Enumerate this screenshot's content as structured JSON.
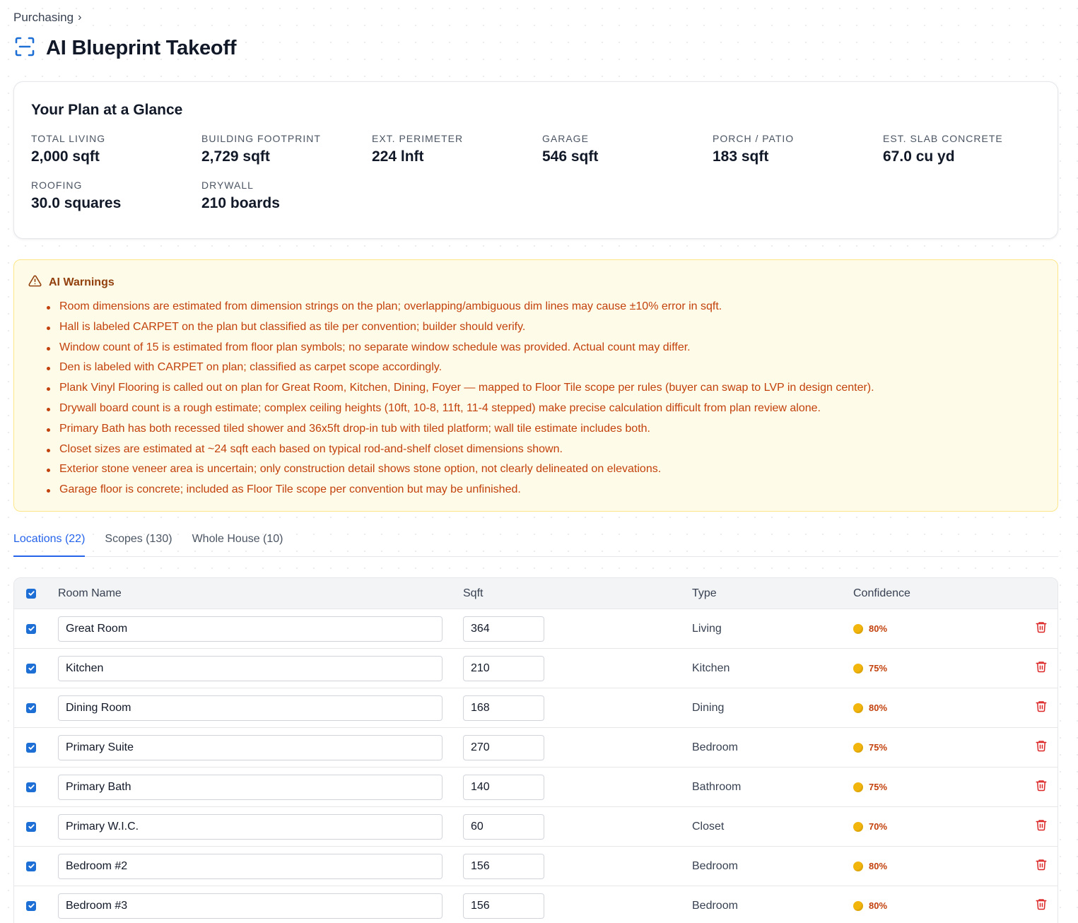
{
  "breadcrumb": {
    "parent": "Purchasing",
    "sep": "›"
  },
  "page": {
    "title": "AI Blueprint Takeoff"
  },
  "glance": {
    "heading": "Your Plan at a Glance",
    "metrics": [
      {
        "label": "TOTAL LIVING",
        "value": "2,000 sqft"
      },
      {
        "label": "BUILDING FOOTPRINT",
        "value": "2,729 sqft"
      },
      {
        "label": "EXT. PERIMETER",
        "value": "224 lnft"
      },
      {
        "label": "GARAGE",
        "value": "546 sqft"
      },
      {
        "label": "PORCH / PATIO",
        "value": "183 sqft"
      },
      {
        "label": "EST. SLAB CONCRETE",
        "value": "67.0 cu yd"
      },
      {
        "label": "ROOFING",
        "value": "30.0 squares"
      },
      {
        "label": "DRYWALL",
        "value": "210 boards"
      }
    ]
  },
  "warnings": {
    "heading": "AI Warnings",
    "items": [
      "Room dimensions are estimated from dimension strings on the plan; overlapping/ambiguous dim lines may cause ±10% error in sqft.",
      "Hall is labeled CARPET on the plan but classified as tile per convention; builder should verify.",
      "Window count of 15 is estimated from floor plan symbols; no separate window schedule was provided. Actual count may differ.",
      "Den is labeled with CARPET on plan; classified as carpet scope accordingly.",
      "Plank Vinyl Flooring is called out on plan for Great Room, Kitchen, Dining, Foyer — mapped to Floor Tile scope per rules (buyer can swap to LVP in design center).",
      "Drywall board count is a rough estimate; complex ceiling heights (10ft, 10-8, 11ft, 11-4 stepped) make precise calculation difficult from plan review alone.",
      "Primary Bath has both recessed tiled shower and 36x5ft drop-in tub with tiled platform; wall tile estimate includes both.",
      "Closet sizes are estimated at ~24 sqft each based on typical rod-and-shelf closet dimensions shown.",
      "Exterior stone veneer area is uncertain; only construction detail shows stone option, not clearly delineated on elevations.",
      "Garage floor is concrete; included as Floor Tile scope per convention but may be unfinished."
    ]
  },
  "tabs": [
    {
      "label": "Locations (22)",
      "active": true
    },
    {
      "label": "Scopes (130)",
      "active": false
    },
    {
      "label": "Whole House (10)",
      "active": false
    }
  ],
  "table": {
    "columns": {
      "name": "Room Name",
      "sqft": "Sqft",
      "type": "Type",
      "confidence": "Confidence"
    },
    "rows": [
      {
        "name": "Great Room",
        "sqft": "364",
        "type": "Living",
        "confidence": "80%"
      },
      {
        "name": "Kitchen",
        "sqft": "210",
        "type": "Kitchen",
        "confidence": "75%"
      },
      {
        "name": "Dining Room",
        "sqft": "168",
        "type": "Dining",
        "confidence": "80%"
      },
      {
        "name": "Primary Suite",
        "sqft": "270",
        "type": "Bedroom",
        "confidence": "75%"
      },
      {
        "name": "Primary Bath",
        "sqft": "140",
        "type": "Bathroom",
        "confidence": "75%"
      },
      {
        "name": "Primary W.I.C.",
        "sqft": "60",
        "type": "Closet",
        "confidence": "70%"
      },
      {
        "name": "Bedroom #2",
        "sqft": "156",
        "type": "Bedroom",
        "confidence": "80%"
      },
      {
        "name": "Bedroom #3",
        "sqft": "156",
        "type": "Bedroom",
        "confidence": "80%"
      }
    ]
  },
  "icons": {
    "title": "scan-icon",
    "warning": "alert-triangle-icon",
    "delete": "trash-icon",
    "confidence": "confidence-dot-icon"
  },
  "colors": {
    "accent": "#2563eb",
    "warning_text": "#c2410c",
    "warning_bg": "#fefce8",
    "confidence_dot": "#f2b50c",
    "delete": "#dc2626"
  }
}
